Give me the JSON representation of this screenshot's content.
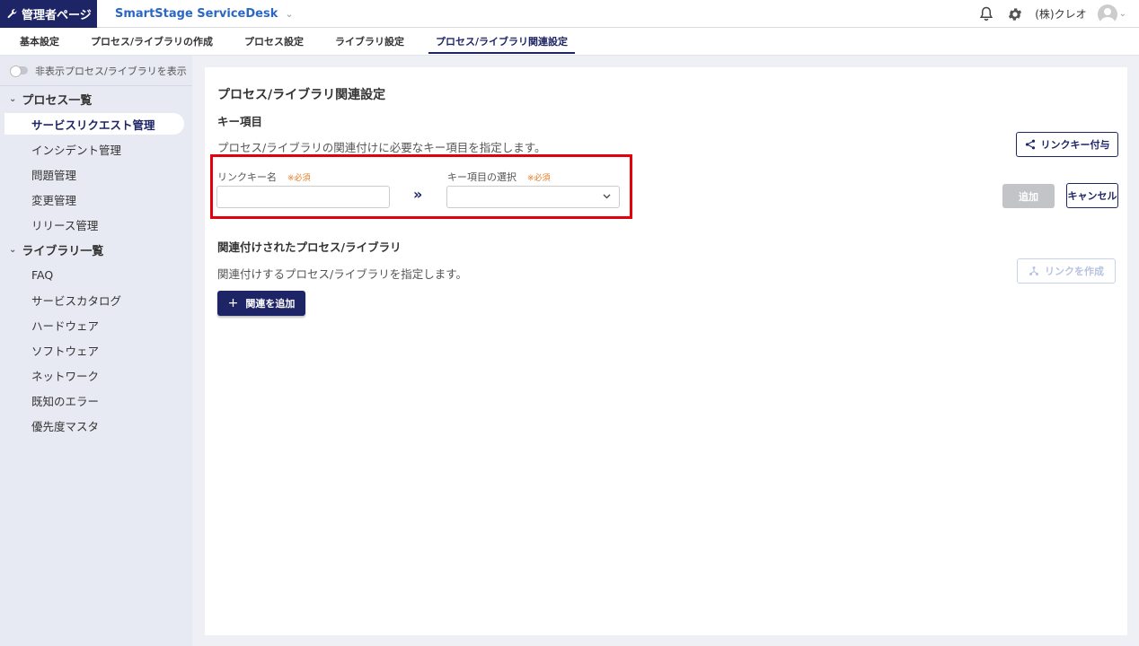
{
  "header": {
    "admin_label": "管理者ページ",
    "app_name": "SmartStage ServiceDesk",
    "org_name": "(株)クレオ"
  },
  "tabs": [
    {
      "label": "基本設定"
    },
    {
      "label": "プロセス/ライブラリの作成"
    },
    {
      "label": "プロセス設定"
    },
    {
      "label": "ライブラリ設定"
    },
    {
      "label": "プロセス/ライブラリ関連設定"
    }
  ],
  "sidebar": {
    "toggle_label": "非表示プロセス/ライブラリを表示",
    "process_group": "プロセス一覧",
    "process_items": [
      "サービスリクエスト管理",
      "インシデント管理",
      "問題管理",
      "変更管理",
      "リリース管理"
    ],
    "library_group": "ライブラリ一覧",
    "library_items": [
      "FAQ",
      "サービスカタログ",
      "ハードウェア",
      "ソフトウェア",
      "ネットワーク",
      "既知のエラー",
      "優先度マスタ"
    ]
  },
  "main": {
    "title": "プロセス/ライブラリ関連設定",
    "key_section": {
      "heading": "キー項目",
      "description": "プロセス/ライブラリの関連付けに必要なキー項目を指定します。",
      "link_key_button": "リンクキー付与",
      "link_key_name_label": "リンクキー名",
      "link_key_name_value": "",
      "required_mark": "※必須",
      "key_select_label": "キー項目の選択",
      "key_select_value": "",
      "arrow": "»",
      "add_button": "追加",
      "cancel_button": "キャンセル"
    },
    "related_section": {
      "heading": "関連付けされたプロセス/ライブラリ",
      "description": "関連付けするプロセス/ライブラリを指定します。",
      "create_link_button": "リンクを作成",
      "add_relation_button": "関連を追加"
    }
  },
  "colors": {
    "primary": "#1e2566",
    "accent_blue": "#2b67c6",
    "required": "#e77b22",
    "highlight": "#e3000b"
  }
}
